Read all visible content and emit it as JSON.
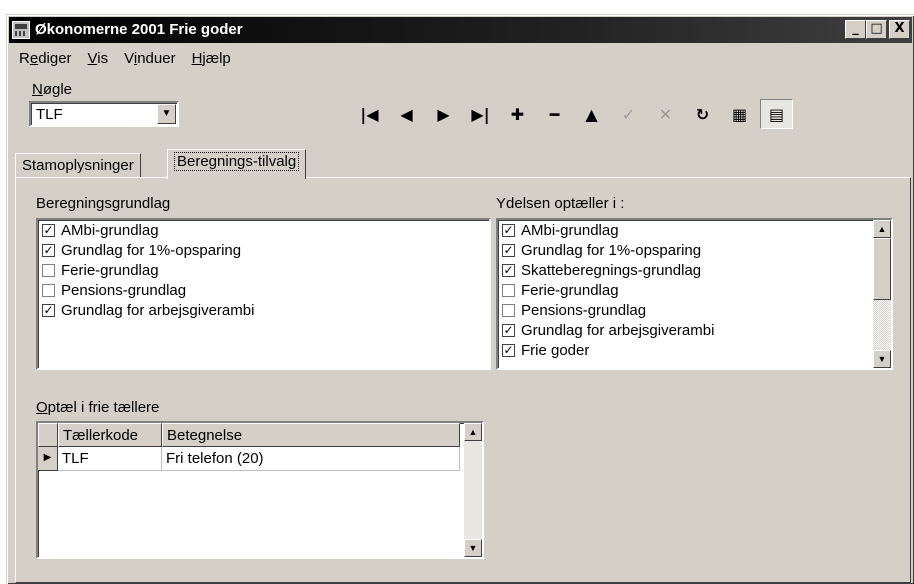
{
  "window": {
    "title": "Økonomerne 2001 Frie goder",
    "controls": {
      "minimize": "_",
      "maximize": "□",
      "close": "X"
    }
  },
  "menu": [
    {
      "label": "Rediger",
      "mnemonic": "e"
    },
    {
      "label": "Vis",
      "mnemonic": "V"
    },
    {
      "label": "Vinduer",
      "mnemonic": "i"
    },
    {
      "label": "Hjælp",
      "mnemonic": "H"
    }
  ],
  "key": {
    "label": "Nøgle",
    "value": "TLF"
  },
  "toolbar": [
    {
      "name": "first-record-icon",
      "glyph": "|◀",
      "enabled": true
    },
    {
      "name": "previous-record-icon",
      "glyph": "◀",
      "enabled": true
    },
    {
      "name": "next-record-icon",
      "glyph": "▶",
      "enabled": true
    },
    {
      "name": "last-record-icon",
      "glyph": "▶|",
      "enabled": true
    },
    {
      "name": "insert-icon",
      "glyph": "✚",
      "enabled": true
    },
    {
      "name": "delete-icon",
      "glyph": "━",
      "enabled": true
    },
    {
      "name": "edit-icon",
      "glyph": "▲",
      "enabled": true
    },
    {
      "name": "post-icon",
      "glyph": "✓",
      "enabled": false
    },
    {
      "name": "cancel-icon",
      "glyph": "✕",
      "enabled": false
    },
    {
      "name": "refresh-icon",
      "glyph": "↻",
      "enabled": true
    },
    {
      "name": "grid-view-icon",
      "glyph": "▦",
      "enabled": true
    },
    {
      "name": "form-view-icon",
      "glyph": "▤",
      "enabled": true,
      "pressed": true
    }
  ],
  "tabs": [
    {
      "label": "Stamoplysninger",
      "active": false
    },
    {
      "label": "Beregnings-tilvalg",
      "active": true
    }
  ],
  "beregningsgrundlag": {
    "label": "Beregningsgrundlag",
    "items": [
      {
        "label": "AMbi-grundlag",
        "checked": true
      },
      {
        "label": "Grundlag for 1%-opsparing",
        "checked": true
      },
      {
        "label": "Ferie-grundlag",
        "checked": false
      },
      {
        "label": "Pensions-grundlag",
        "checked": false
      },
      {
        "label": "Grundlag for arbejsgiverambi",
        "checked": true
      }
    ]
  },
  "ydelsen": {
    "label": "Ydelsen optæller i :",
    "items": [
      {
        "label": "AMbi-grundlag",
        "checked": true
      },
      {
        "label": "Grundlag for 1%-opsparing",
        "checked": true
      },
      {
        "label": "Skatteberegnings-grundlag",
        "checked": true
      },
      {
        "label": "Ferie-grundlag",
        "checked": false
      },
      {
        "label": "Pensions-grundlag",
        "checked": false
      },
      {
        "label": "Grundlag for arbejsgiverambi",
        "checked": true
      },
      {
        "label": "Frie goder",
        "checked": true
      }
    ]
  },
  "counters": {
    "label": "Optæl i frie tællere",
    "columns": [
      "Tællerkode",
      "Betegnelse"
    ],
    "rows": [
      {
        "code": "TLF",
        "name": "Fri telefon (20)"
      }
    ]
  },
  "colors": {
    "face": "#d4d0c8",
    "title_bar": "#000000",
    "field": "#ffffff"
  }
}
